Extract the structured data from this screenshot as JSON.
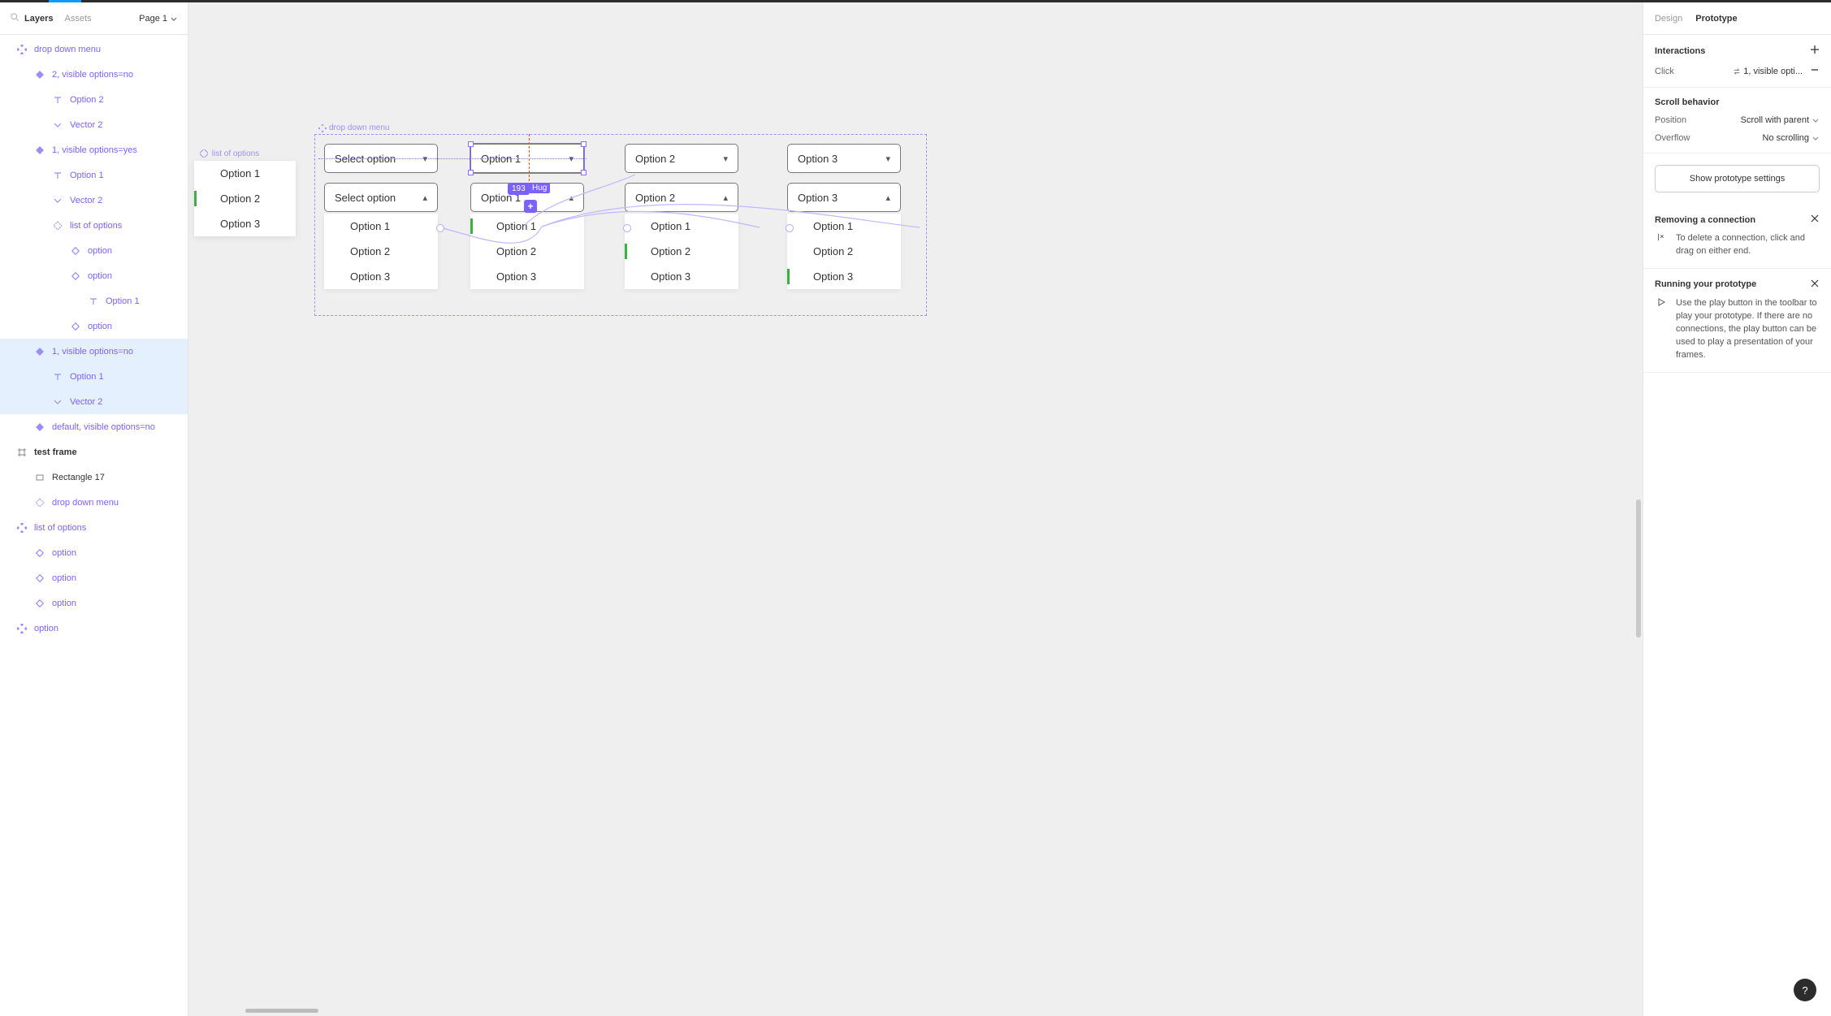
{
  "leftPanel": {
    "tabs": {
      "layers": "Layers",
      "assets": "Assets"
    },
    "page": "Page 1",
    "items": [
      {
        "label": "drop down menu",
        "icon": "component4",
        "indent": 0,
        "purple": true
      },
      {
        "label": "2, visible options=no",
        "icon": "diamond",
        "indent": 1,
        "purple": true
      },
      {
        "label": "Option 2",
        "icon": "text",
        "indent": 2,
        "purple": true
      },
      {
        "label": "Vector 2",
        "icon": "chevdown",
        "indent": 2,
        "purple": true
      },
      {
        "label": "1, visible options=yes",
        "icon": "diamond",
        "indent": 1,
        "purple": true
      },
      {
        "label": "Option 1",
        "icon": "text",
        "indent": 2,
        "purple": true
      },
      {
        "label": "Vector 2",
        "icon": "chevdown",
        "indent": 2,
        "purple": true
      },
      {
        "label": "list of options",
        "icon": "instance",
        "indent": 2,
        "purple": true
      },
      {
        "label": "option",
        "icon": "diamondo",
        "indent": 3,
        "purple": true
      },
      {
        "label": "option",
        "icon": "diamondo",
        "indent": 3,
        "purple": true
      },
      {
        "label": "Option 1",
        "icon": "text",
        "indent": 4,
        "purple": true
      },
      {
        "label": "option",
        "icon": "diamondo",
        "indent": 3,
        "purple": true
      },
      {
        "label": "1, visible options=no",
        "icon": "diamond",
        "indent": 1,
        "purple": true,
        "selected": true
      },
      {
        "label": "Option 1",
        "icon": "text",
        "indent": 2,
        "purple": true,
        "selbg": true
      },
      {
        "label": "Vector 2",
        "icon": "chevdown",
        "indent": 2,
        "purple": true,
        "selbg": true
      },
      {
        "label": "default, visible options=no",
        "icon": "diamond",
        "indent": 1,
        "purple": true
      },
      {
        "label": "test frame",
        "icon": "frame",
        "indent": 0,
        "purple": false,
        "bold": true
      },
      {
        "label": "Rectangle 17",
        "icon": "rect",
        "indent": 1,
        "purple": false
      },
      {
        "label": "drop down menu",
        "icon": "instance",
        "indent": 1,
        "purple": true
      },
      {
        "label": "list of options",
        "icon": "component4",
        "indent": 0,
        "purple": true
      },
      {
        "label": "option",
        "icon": "diamondo",
        "indent": 1,
        "purple": true
      },
      {
        "label": "option",
        "icon": "diamondo",
        "indent": 1,
        "purple": true
      },
      {
        "label": "option",
        "icon": "diamondo",
        "indent": 1,
        "purple": true
      },
      {
        "label": "option",
        "icon": "component4",
        "indent": 0,
        "purple": true
      }
    ]
  },
  "canvas": {
    "listOptionsLabel": "list of options",
    "listOptions": [
      "Option 1",
      "Option 2",
      "Option 3"
    ],
    "ddLabel": "drop down menu",
    "dimBadge": "193",
    "hugBadge": "Hug",
    "row1": [
      {
        "label": "Select option",
        "chev": "down"
      },
      {
        "label": "Option 1",
        "chev": "down",
        "selected": true
      },
      {
        "label": "Option 2",
        "chev": "down"
      },
      {
        "label": "Option 3",
        "chev": "down"
      }
    ],
    "row2": [
      {
        "label": "Select option",
        "chev": "up"
      },
      {
        "label": "Option 1",
        "chev": "up"
      },
      {
        "label": "Option 2",
        "chev": "up"
      },
      {
        "label": "Option 3",
        "chev": "up"
      }
    ],
    "optionLists": [
      {
        "items": [
          "Option 1",
          "Option 2",
          "Option 3"
        ],
        "mark": -1
      },
      {
        "items": [
          "Option 1",
          "Option 2",
          "Option 3"
        ],
        "mark": 0
      },
      {
        "items": [
          "Option 1",
          "Option 2",
          "Option 3"
        ],
        "mark": 1
      },
      {
        "items": [
          "Option 1",
          "Option 2",
          "Option 3"
        ],
        "mark": 2
      }
    ]
  },
  "rightPanel": {
    "tabs": {
      "design": "Design",
      "prototype": "Prototype"
    },
    "interactions": {
      "title": "Interactions",
      "trigger": "Click",
      "target": "1, visible opti..."
    },
    "scroll": {
      "title": "Scroll behavior",
      "positionLabel": "Position",
      "positionValue": "Scroll with parent",
      "overflowLabel": "Overflow",
      "overflowValue": "No scrolling"
    },
    "protoBtn": "Show prototype settings",
    "hint1": {
      "title": "Removing a connection",
      "body": "To delete a connection, click and drag on either end."
    },
    "hint2": {
      "title": "Running your prototype",
      "body": "Use the play button in the toolbar to play your prototype. If there are no connections, the play button can be used to play a presentation of your frames."
    }
  }
}
